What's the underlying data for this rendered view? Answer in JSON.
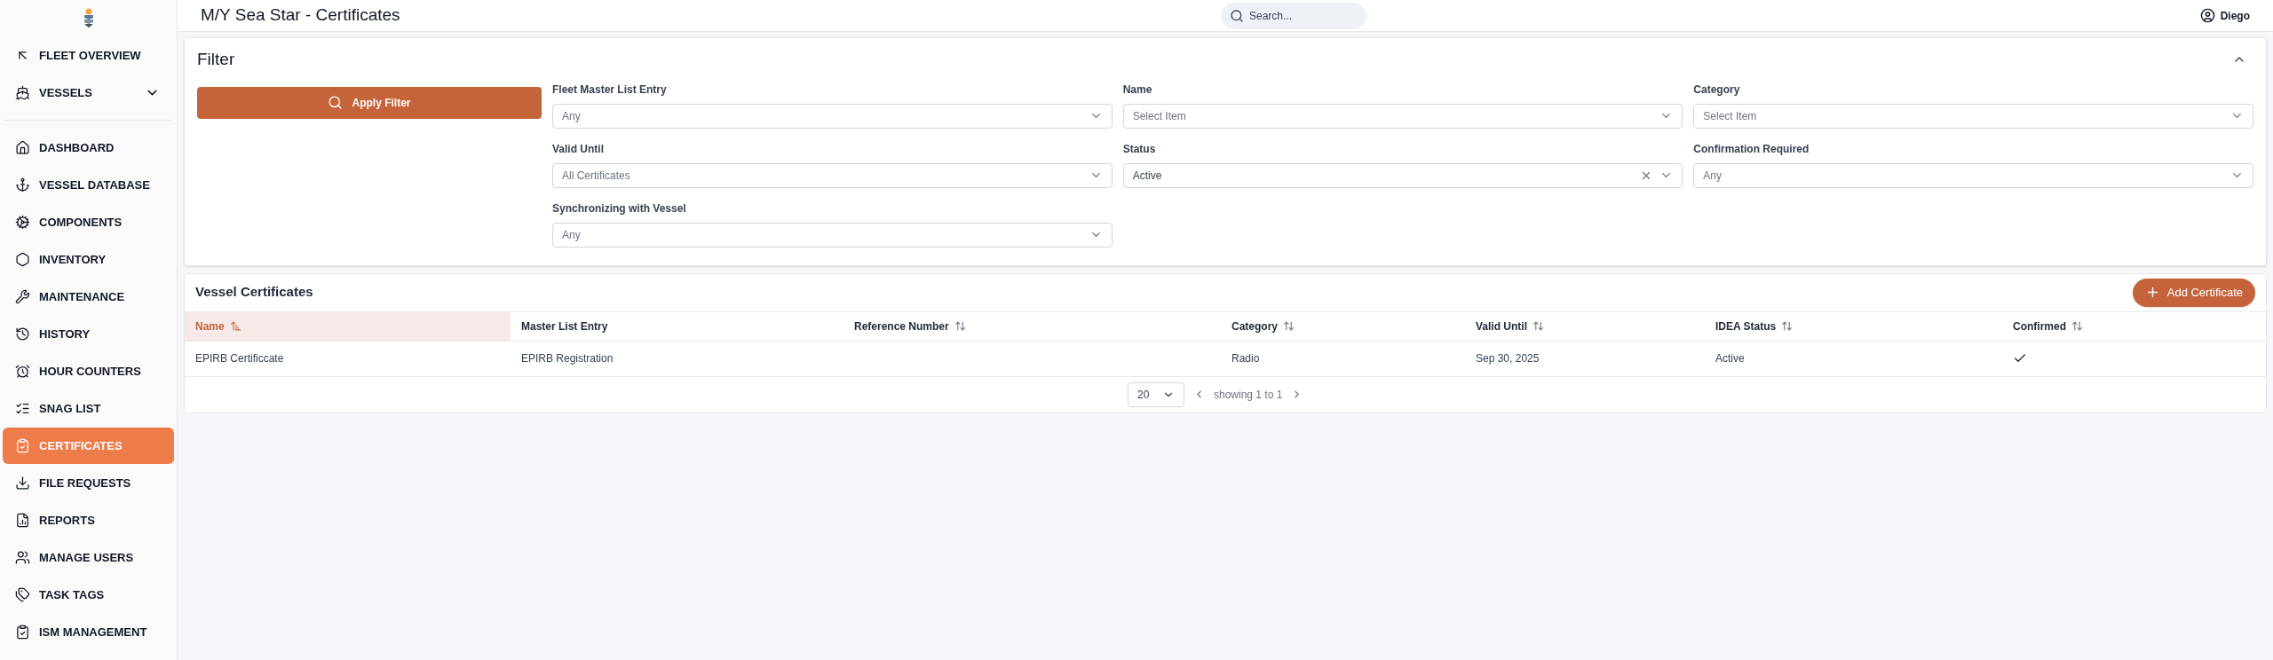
{
  "header": {
    "title": "M/Y Sea Star - Certificates",
    "search": {
      "placeholder": "Search..."
    },
    "user": "Diego"
  },
  "sidebar": {
    "top_items": [
      {
        "label": "FLEET OVERVIEW",
        "selected": false
      },
      {
        "label": "VESSELS",
        "selected": false
      }
    ],
    "items": [
      {
        "label": "DASHBOARD",
        "selected": false
      },
      {
        "label": "VESSEL DATABASE",
        "selected": false
      },
      {
        "label": "COMPONENTS",
        "selected": false
      },
      {
        "label": "INVENTORY",
        "selected": false
      },
      {
        "label": "MAINTENANCE",
        "selected": false
      },
      {
        "label": "HISTORY",
        "selected": false
      },
      {
        "label": "HOUR COUNTERS",
        "selected": false
      },
      {
        "label": "SNAG LIST",
        "selected": false
      },
      {
        "label": "CERTIFICATES",
        "selected": true
      },
      {
        "label": "FILE REQUESTS",
        "selected": false
      },
      {
        "label": "REPORTS",
        "selected": false
      },
      {
        "label": "MANAGE USERS",
        "selected": false
      },
      {
        "label": "TASK TAGS",
        "selected": false
      },
      {
        "label": "ISM MANAGEMENT",
        "selected": false
      }
    ]
  },
  "filter": {
    "title": "Filter",
    "apply_button": "Apply Filter",
    "fields": [
      {
        "label": "Fleet Master List Entry",
        "value": "Any",
        "clearable": false
      },
      {
        "label": "Name",
        "placeholder": "Select Item",
        "clearable": false
      },
      {
        "label": "Category",
        "placeholder": "Select Item",
        "clearable": false
      },
      {
        "label": "Valid Until",
        "value": "All Certificates",
        "clearable": false
      },
      {
        "label": "Status",
        "value": "Active",
        "clearable": true
      },
      {
        "label": "Confirmation Required",
        "value": "Any",
        "clearable": false
      },
      {
        "label": "Synchronizing with Vessel",
        "value": "Any",
        "clearable": false
      }
    ]
  },
  "certificates": {
    "title": "Vessel Certificates",
    "add_button": "Add Certificate",
    "columns": [
      {
        "label": "Name",
        "sortable": true,
        "selected": true
      },
      {
        "label": "Master List Entry",
        "sortable": false,
        "selected": false
      },
      {
        "label": "Reference Number",
        "sortable": true,
        "selected": false
      },
      {
        "label": "Category",
        "sortable": true,
        "selected": false
      },
      {
        "label": "Valid Until",
        "sortable": true,
        "selected": false
      },
      {
        "label": "IDEA Status",
        "sortable": true,
        "selected": false
      },
      {
        "label": "Confirmed",
        "sortable": true,
        "selected": false
      }
    ],
    "rows": [
      {
        "name": "EPIRB Certificcate",
        "master_list_entry": "EPIRB Registration",
        "category": "Radio",
        "valid_until": "Sep 30, 2025",
        "status": "Active",
        "confirmed": true
      }
    ],
    "pagination": {
      "page_size": "20",
      "showing": "showing 1 to 1"
    }
  }
}
